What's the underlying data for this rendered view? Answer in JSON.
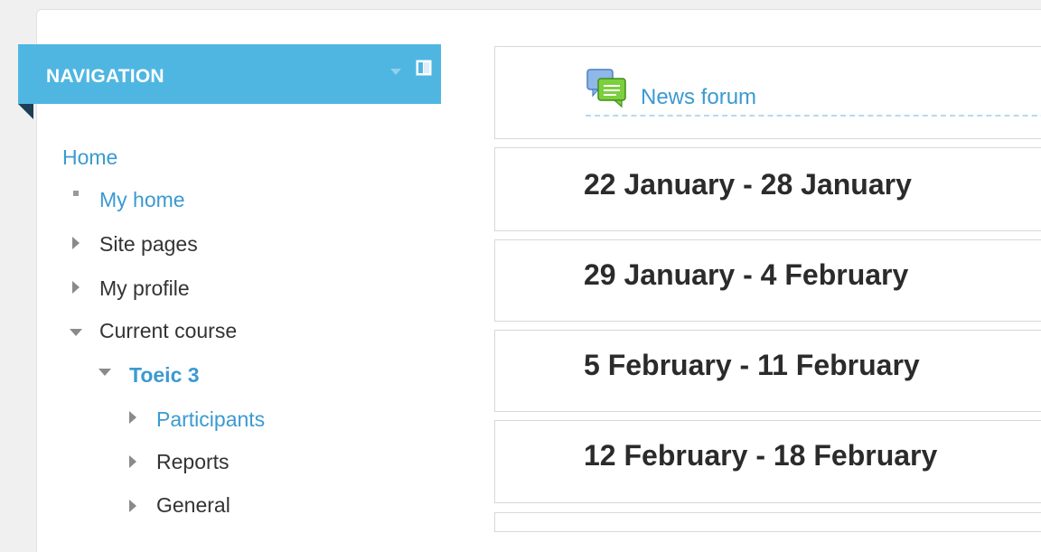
{
  "navigation": {
    "title": "NAVIGATION",
    "items": [
      {
        "label": "Home"
      },
      {
        "label": "My home"
      },
      {
        "label": "Site pages"
      },
      {
        "label": "My profile"
      },
      {
        "label": "Current course"
      },
      {
        "label": "Toeic 3"
      },
      {
        "label": "Participants"
      },
      {
        "label": "Reports"
      },
      {
        "label": "General"
      }
    ]
  },
  "course": {
    "news_forum": {
      "label": "News forum"
    },
    "sections": [
      {
        "title": "22 January - 28 January"
      },
      {
        "title": "29 January - 4 February"
      },
      {
        "title": "5 February - 11 February"
      },
      {
        "title": "12 February - 18 February"
      }
    ]
  },
  "colors": {
    "nav_header": "#4fb6e1",
    "link": "#3b9ad1",
    "fold": "#1d3f55"
  },
  "icons": {
    "collapse": "chevron-down-icon",
    "dock": "dock-icon",
    "forum": "forum-chat-icon"
  }
}
